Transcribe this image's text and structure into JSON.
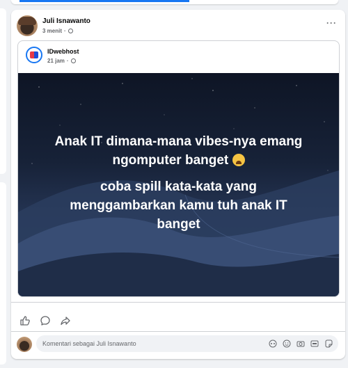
{
  "post": {
    "author": "Juli Isnawanto",
    "time": "3 menit",
    "separator": "·",
    "more": "···"
  },
  "shared": {
    "page_name": "IDwebhost",
    "time": "21 jam",
    "separator": "·"
  },
  "image": {
    "line1": "Anak IT dimana-mana vibes-nya emang",
    "line2": "ngomputer banget",
    "emoji": "crying-face",
    "line3": "coba spill kata-kata yang",
    "line4": "menggambarkan kamu tuh anak IT",
    "line5": "banget"
  },
  "actions": [
    "like-icon",
    "comment-icon",
    "share-icon"
  ],
  "comment": {
    "placeholder": "Komentari sebagai Juli Isnawanto",
    "icons": [
      "avatar-sticker-icon",
      "emoji-icon",
      "camera-icon",
      "gif-icon",
      "sticker-icon"
    ]
  },
  "colors": {
    "accent": "#1877f2",
    "text": "#050505",
    "muted": "#65676b",
    "background": "#f0f2f5"
  }
}
